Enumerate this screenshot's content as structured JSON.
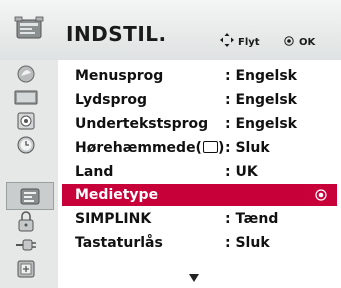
{
  "header": {
    "title": "INDSTIL.",
    "hint_move": "Flyt",
    "hint_ok": "OK"
  },
  "menu": {
    "rows": [
      {
        "label": "Menusprog",
        "value": ": Engelsk"
      },
      {
        "label": "Lydsprog",
        "value": ": Engelsk"
      },
      {
        "label": "Undertekstsprog",
        "value": ": Engelsk"
      },
      {
        "label": "Hørehæmmede(",
        "label_suffix": ")",
        "value": ": Sluk"
      },
      {
        "label": "Land",
        "value": ": UK"
      },
      {
        "label": "Medietype",
        "value": ""
      },
      {
        "label": "SIMPLINK",
        "value": ": Tænd"
      },
      {
        "label": "Tastaturlås",
        "value": ": Sluk"
      }
    ],
    "selected_index": 5
  },
  "sidebar": {
    "icons": [
      "settings-menu-icon",
      "picture-icon",
      "tv-screen-icon",
      "audio-icon",
      "clock-icon",
      "option-icon",
      "lock-icon",
      "input-icon",
      "usb-icon"
    ],
    "active_index": 5
  },
  "colors": {
    "accent": "#c8003a",
    "background": "#ffffff",
    "sidebar": "#e6e8e8"
  }
}
